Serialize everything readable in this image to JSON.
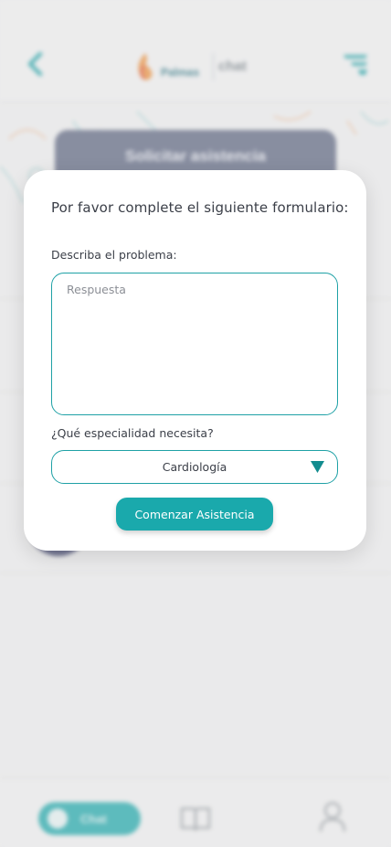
{
  "header": {
    "logo_brand": "Palmas",
    "logo_app": "chat"
  },
  "background": {
    "request_button_label": "Solicitar asistencia",
    "nav": {
      "chat_label": "Chat"
    }
  },
  "modal": {
    "title": "Por favor complete el siguiente formulario:",
    "problem_label": "Describa el problema:",
    "problem_placeholder": "Respuesta",
    "problem_value": "",
    "specialty_label": "¿Qué especialidad necesita?",
    "specialty_value": "Cardiología",
    "start_button_label": "Comenzar Asistencia"
  },
  "colors": {
    "accent": "#1aa9ac",
    "border": "#1fa1a6",
    "text": "#3b3f48",
    "request_button": "#5b6480"
  },
  "icons": {
    "back": "chevron-left-icon",
    "menu": "menu-icon",
    "dropdown": "triangle-down-icon",
    "book": "book-icon",
    "user": "user-icon"
  }
}
